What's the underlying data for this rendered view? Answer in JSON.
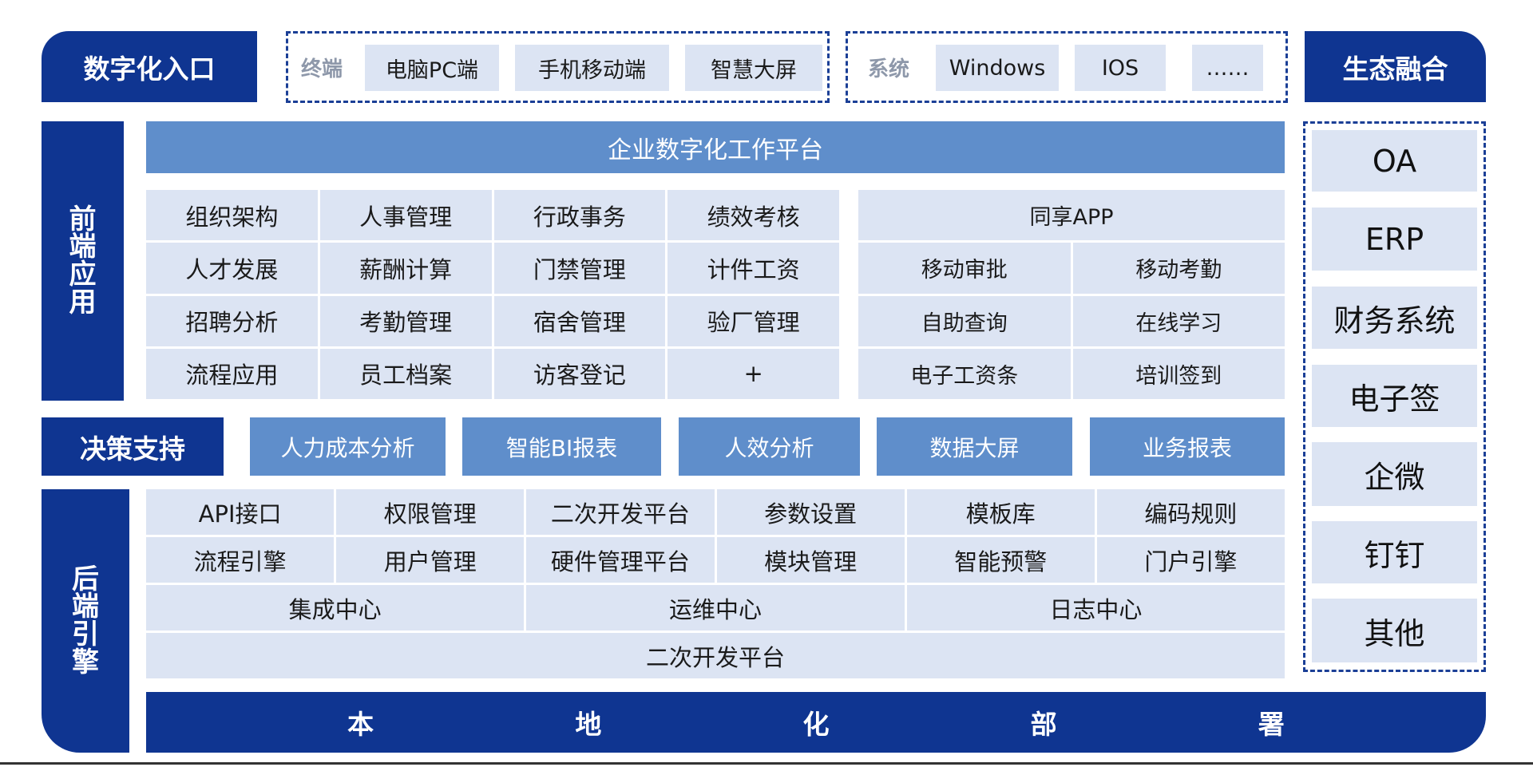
{
  "top": {
    "entry": "数字化入口",
    "terminal_label": "终端",
    "terminals": [
      "电脑PC端",
      "手机移动端",
      "智慧大屏"
    ],
    "system_label": "系统",
    "systems": [
      "Windows",
      "IOS",
      "……"
    ],
    "ecosystem": "生态融合"
  },
  "front": {
    "label_chars": [
      "前",
      "端",
      "应",
      "用"
    ],
    "platform": "企业数字化工作平台",
    "modules": [
      [
        "组织架构",
        "人事管理",
        "行政事务",
        "绩效考核"
      ],
      [
        "人才发展",
        "薪酬计算",
        "门禁管理",
        "计件工资"
      ],
      [
        "招聘分析",
        "考勤管理",
        "宿舍管理",
        "验厂管理"
      ],
      [
        "流程应用",
        "员工档案",
        "访客登记",
        "+"
      ]
    ],
    "app_title": "同享APP",
    "app_items": [
      [
        "移动审批",
        "移动考勤"
      ],
      [
        "自助查询",
        "在线学习"
      ],
      [
        "电子工资条",
        "培训签到"
      ]
    ]
  },
  "decision": {
    "label": "决策支持",
    "items": [
      "人力成本分析",
      "智能BI报表",
      "人效分析",
      "数据大屏",
      "业务报表"
    ]
  },
  "backend": {
    "label_chars": [
      "后",
      "端",
      "引",
      "擎"
    ],
    "row1": [
      "API接口",
      "权限管理",
      "二次开发平台",
      "参数设置",
      "模板库",
      "编码规则"
    ],
    "row2": [
      "流程引擎",
      "用户管理",
      "硬件管理平台",
      "模块管理",
      "智能预警",
      "门户引擎"
    ],
    "row3": [
      "集成中心",
      "运维中心",
      "日志中心"
    ],
    "row4": "二次开发平台"
  },
  "deploy": {
    "chars": [
      "本",
      "地",
      "化",
      "部",
      "署"
    ]
  },
  "ecosystem_items": [
    "OA",
    "ERP",
    "财务系统",
    "电子签",
    "企微",
    "钉钉",
    "其他"
  ]
}
